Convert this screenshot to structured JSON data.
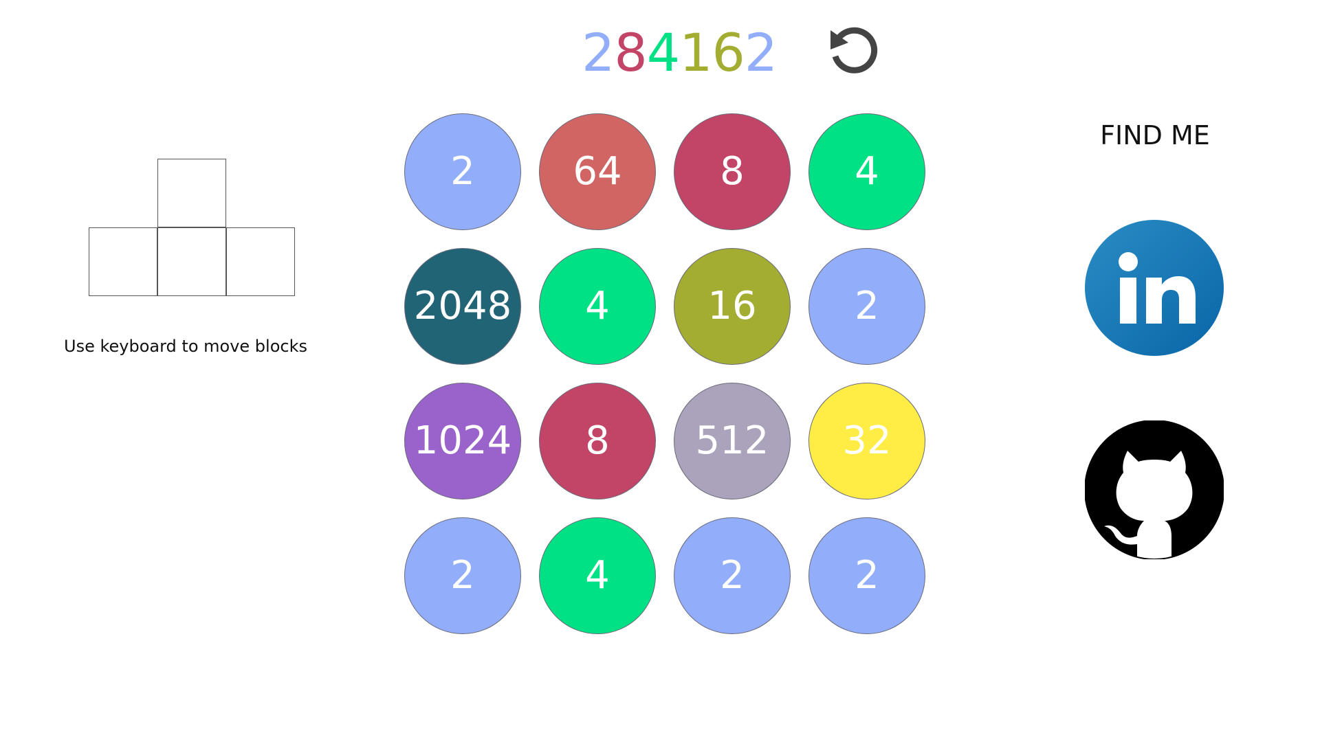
{
  "title": {
    "digits": [
      {
        "char": "2",
        "color": "#92aefb"
      },
      {
        "char": "8",
        "color": "#c24466"
      },
      {
        "char": "4",
        "color": "#00e085"
      },
      {
        "char": "1",
        "color": "#a3ad32"
      },
      {
        "char": "6",
        "color": "#a3ad32"
      },
      {
        "char": "2",
        "color": "#92aefb"
      }
    ]
  },
  "toolbar": {
    "undo_icon": "undo-icon"
  },
  "help": {
    "text": "Use keyboard to move blocks",
    "keys": [
      "up",
      "left",
      "down",
      "right"
    ]
  },
  "board": {
    "rows": [
      [
        {
          "value": "2",
          "color": "#92aefb"
        },
        {
          "value": "64",
          "color": "#d16564"
        },
        {
          "value": "8",
          "color": "#c24466"
        },
        {
          "value": "4",
          "color": "#00e085"
        }
      ],
      [
        {
          "value": "2048",
          "color": "#216475"
        },
        {
          "value": "4",
          "color": "#00e085"
        },
        {
          "value": "16",
          "color": "#a3ad32"
        },
        {
          "value": "2",
          "color": "#92aefb"
        }
      ],
      [
        {
          "value": "1024",
          "color": "#9a63cb"
        },
        {
          "value": "8",
          "color": "#c24466"
        },
        {
          "value": "512",
          "color": "#aba3bb"
        },
        {
          "value": "32",
          "color": "#ffec45"
        }
      ],
      [
        {
          "value": "2",
          "color": "#92aefb"
        },
        {
          "value": "4",
          "color": "#00e085"
        },
        {
          "value": "2",
          "color": "#92aefb"
        },
        {
          "value": "2",
          "color": "#92aefb"
        }
      ]
    ]
  },
  "social": {
    "heading": "FIND ME",
    "links": [
      {
        "name": "linkedin",
        "icon": "linkedin-icon",
        "label": "in"
      },
      {
        "name": "github",
        "icon": "github-icon"
      }
    ]
  }
}
